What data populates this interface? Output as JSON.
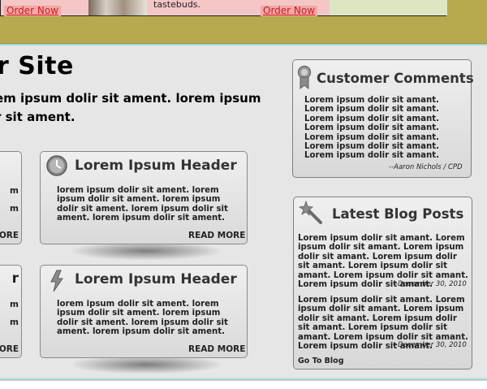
{
  "banner": {
    "order_now_left": "Order Now",
    "order_now_right": "Order Now",
    "tastebuds": "tastebuds."
  },
  "main": {
    "title": "r Site",
    "intro": "em ipsum dolir sit ament. lorem ipsum r sit ament."
  },
  "left_stubs": {
    "top": [
      "m",
      "m",
      "ORE"
    ],
    "bottom": [
      "r",
      "m",
      "m",
      "ORE"
    ]
  },
  "cards": [
    {
      "header": "Lorem Ipsum Header",
      "icon": "clock-icon",
      "body": "lorem ipsum dolir sit ament. lorem ipsum dolir sit ament. lorem ipsum dolir sit ament. lorem ipsum dolir sit ament. lorem ipsum dolir sit ament.",
      "read_more": "READ MORE"
    },
    {
      "header": "Lorem Ipsum Header",
      "icon": "lightning-icon",
      "body": "lorem ipsum dolir sit ament. lorem ipsum dolir sit ament. lorem ipsum dolir sit ament. lorem ipsum dolir sit ament. lorem ipsum dolir sit ament.",
      "read_more": "READ MORE"
    }
  ],
  "sidebar": {
    "comments": {
      "title": "Customer Comments",
      "icon": "ribbon-award-icon",
      "text": "Lorem ipsum dolir sit amant. Lorem ipsum dolir sit amant. Lorem ipsum dolir sit amant. Lorem ipsum dolir sit amant. Lorem ipsum dolir sit amant. Lorem ipsum dolir sit amant. Lorem ipsum dolir sit amant.",
      "signature": "--Aaron Nichols / CPD"
    },
    "blog": {
      "title": "Latest Blog Posts",
      "icon": "magic-wand-icon",
      "posts": [
        {
          "text": "Lorem ipsum dolir sit amant. Lorem ipsum dolir sit amant. Lorem ipsum dolir sit amant. Lorem ipsum dolir sit amant. Lorem ipsum dolir sit amant. Lorem ipsum dolir sit amant. Lorem ipsum dolir sit amant.",
          "date": "--December 30, 2010"
        },
        {
          "text": "Lorem ipsum dolir sit amant. Lorem ipsum dolir sit amant. Lorem ipsum dolir sit amant. Lorem ipsum dolir sit amant. Lorem ipsum dolir sit amant. Lorem ipsum dolir sit amant. Lorem ipsum dolir sit amant.",
          "date": "--December 30, 2010"
        }
      ],
      "link": "Go To Blog"
    }
  },
  "colors": {
    "banner": "#b6a94e",
    "page_bg": "#e6e6e6",
    "order_link": "#d21a1a"
  }
}
